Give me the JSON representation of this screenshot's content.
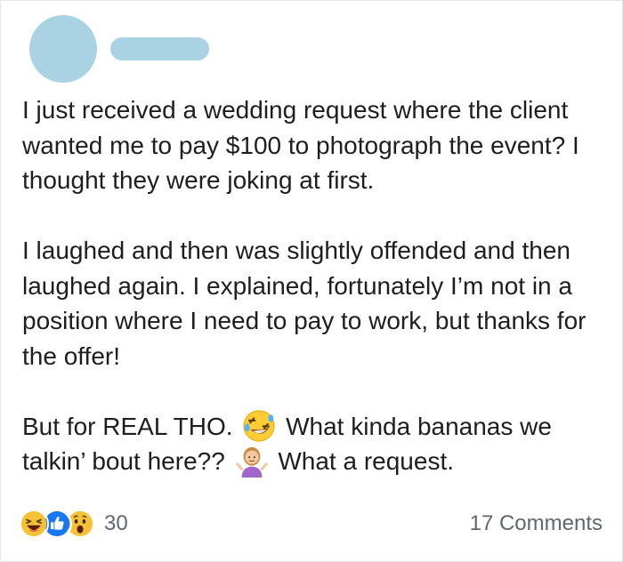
{
  "post": {
    "paragraphs": [
      "I just received a wedding request where the client wanted me to pay $100 to photograph the event? I thought they were joking at first.",
      "I laughed and then was slightly offended and then laughed again. I explained, fortunately I’m not in a position where I need to pay to work, but thanks for the offer!"
    ],
    "last_paragraph": {
      "part1": "But for REAL THO.",
      "emoji1": "rolling-on-floor-laughing-emoji",
      "part2": "What kinda bananas we talkin’ bout here??",
      "emoji2": "person-shrugging-emoji",
      "part3": "What a request."
    }
  },
  "reactions": {
    "icons": [
      "laughing-reaction-icon",
      "like-reaction-icon",
      "wow-reaction-icon"
    ],
    "count": "30"
  },
  "comments": {
    "label": "17 Comments"
  },
  "colors": {
    "placeholder": "#a9d3e3",
    "text": "#1c1e21",
    "meta": "#606770",
    "like_blue": "#1877f2",
    "reaction_yellow": "#f7c136"
  }
}
